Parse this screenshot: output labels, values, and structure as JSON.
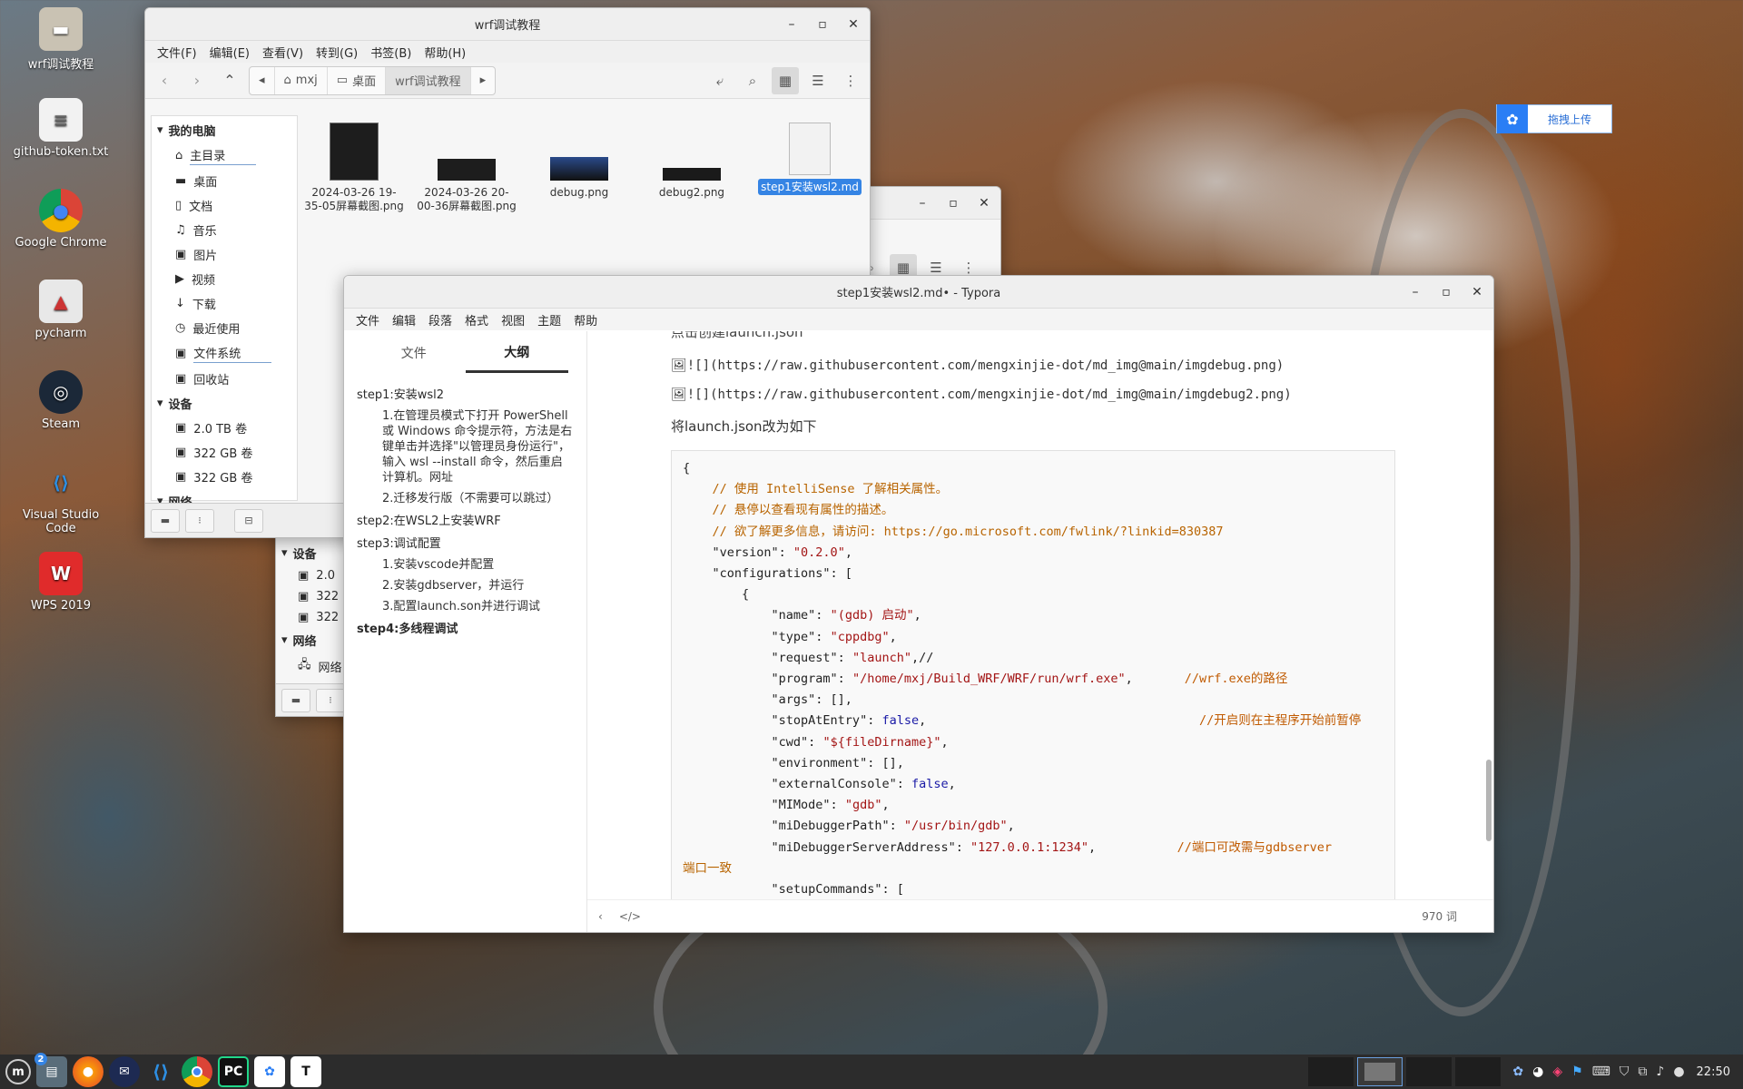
{
  "desktop": {
    "icons": [
      {
        "name": "wrf-folder",
        "label": "wrf调试教程",
        "icon": "folder-icon"
      },
      {
        "name": "github-token",
        "label": "github-token.txt",
        "icon": "text-file-icon"
      },
      {
        "name": "chrome",
        "label": "Google Chrome",
        "icon": "chrome-icon"
      },
      {
        "name": "pycharm",
        "label": "pycharm",
        "icon": "pycharm-icon"
      },
      {
        "name": "steam",
        "label": "Steam",
        "icon": "steam-icon"
      },
      {
        "name": "vscode",
        "label": "Visual Studio Code",
        "icon": "vscode-icon"
      },
      {
        "name": "wps",
        "label": "WPS 2019",
        "icon": "wps-icon"
      }
    ],
    "upload_widget": {
      "label": "拖拽上传"
    }
  },
  "file_manager": {
    "title": "wrf调试教程",
    "menu": [
      "文件(F)",
      "编辑(E)",
      "查看(V)",
      "转到(G)",
      "书签(B)",
      "帮助(H)"
    ],
    "breadcrumbs": [
      "mxj",
      "桌面",
      "wrf调试教程"
    ],
    "sidebar": {
      "my_computer": "我的电脑",
      "places": [
        "主目录",
        "桌面",
        "文档",
        "音乐",
        "图片",
        "视频",
        "下载",
        "最近使用",
        "文件系统",
        "回收站"
      ],
      "devices_label": "设备",
      "devices": [
        "2.0 TB 卷",
        "322 GB 卷",
        "322 GB 卷"
      ],
      "network_label": "网络",
      "network": [
        "网络"
      ]
    },
    "files": [
      {
        "name": "2024-03-26 19-35-05屏幕截图.png"
      },
      {
        "name": "2024-03-26 20-00-36屏幕截图.png"
      },
      {
        "name": "debug.png"
      },
      {
        "name": "debug2.png"
      },
      {
        "name": "step1安装wsl2.md"
      }
    ]
  },
  "back_window": {
    "sidebar": {
      "devices_label": "设备",
      "devices": [
        "2.0",
        "322",
        "322"
      ],
      "network_label": "网络",
      "network": [
        "网络"
      ]
    }
  },
  "typora": {
    "title": "step1安装wsl2.md• - Typora",
    "menu": [
      "文件",
      "编辑",
      "段落",
      "格式",
      "视图",
      "主题",
      "帮助"
    ],
    "tabs": [
      "文件",
      "大纲"
    ],
    "outline": [
      {
        "level": 1,
        "text": "step1:安装wsl2"
      },
      {
        "level": 2,
        "text": "1.在管理员模式下打开 PowerShell 或 Windows 命令提示符，方法是右键单击并选择\"以管理员身份运行\"，输入 wsl --install 命令，然后重启计算机。网址"
      },
      {
        "level": 2,
        "text": "2.迁移发行版（不需要可以跳过）"
      },
      {
        "level": 1,
        "text": "step2:在WSL2上安装WRF"
      },
      {
        "level": 1,
        "text": "step3:调试配置"
      },
      {
        "level": 2,
        "text": "1.安装vscode并配置"
      },
      {
        "level": 2,
        "text": "2.安装gdbserver，并运行"
      },
      {
        "level": 2,
        "text": "3.配置launch.son并进行调试"
      },
      {
        "level": 1,
        "text": "step4:多线程调试",
        "bold": true
      }
    ],
    "content": {
      "partial_heading": "点击创建launch.json",
      "img1": "![](https://raw.githubusercontent.com/mengxinjie-dot/md_img@main/imgdebug.png)",
      "img2": "![](https://raw.githubusercontent.com/mengxinjie-dot/md_img@main/imgdebug2.png)",
      "para": "将launch.json改为如下",
      "code_lines": [
        [
          "p",
          "{"
        ],
        [
          "c",
          "    // 使用 IntelliSense 了解相关属性。"
        ],
        [
          "c",
          "    // 悬停以查看现有属性的描述。"
        ],
        [
          "c",
          "    // 欲了解更多信息，请访问: https://go.microsoft.com/fwlink/?linkid=830387"
        ],
        [
          "kv",
          "    \"version\": ",
          "\"0.2.0\"",
          ","
        ],
        [
          "p",
          "    \"configurations\": ["
        ],
        [
          "p",
          "        {"
        ],
        [
          "kv",
          "            \"name\": ",
          "\"(gdb) 启动\"",
          ","
        ],
        [
          "kv",
          "            \"type\": ",
          "\"cppdbg\"",
          ","
        ],
        [
          "kvc",
          "            \"request\": ",
          "\"launch\"",
          ",//",
          ""
        ],
        [
          "kvc",
          "            \"program\": ",
          "\"/home/mxj/Build_WRF/WRF/run/wrf.exe\"",
          ",       ",
          "//wrf.exe的路径"
        ],
        [
          "p",
          "            \"args\": [],"
        ],
        [
          "kbc",
          "            \"stopAtEntry\": ",
          "false",
          ",                                     ",
          "//开启则在主程序开始前暂停"
        ],
        [
          "kv",
          "            \"cwd\": ",
          "\"${fileDirname}\"",
          ","
        ],
        [
          "p",
          "            \"environment\": [],"
        ],
        [
          "kb",
          "            \"externalConsole\": ",
          "false",
          ","
        ],
        [
          "kv",
          "            \"MIMode\": ",
          "\"gdb\"",
          ","
        ],
        [
          "kv",
          "            \"miDebuggerPath\": ",
          "\"/usr/bin/gdb\"",
          ","
        ],
        [
          "kvc",
          "            \"miDebuggerServerAddress\": ",
          "\"127.0.0.1:1234\"",
          ",           ",
          "//端口可改需与gdbserver"
        ],
        [
          "c",
          "端口一致"
        ],
        [
          "p",
          "            \"setupCommands\": ["
        ]
      ]
    },
    "word_count": "970 词"
  },
  "taskbar": {
    "clock": "22:50",
    "badge": "2"
  }
}
